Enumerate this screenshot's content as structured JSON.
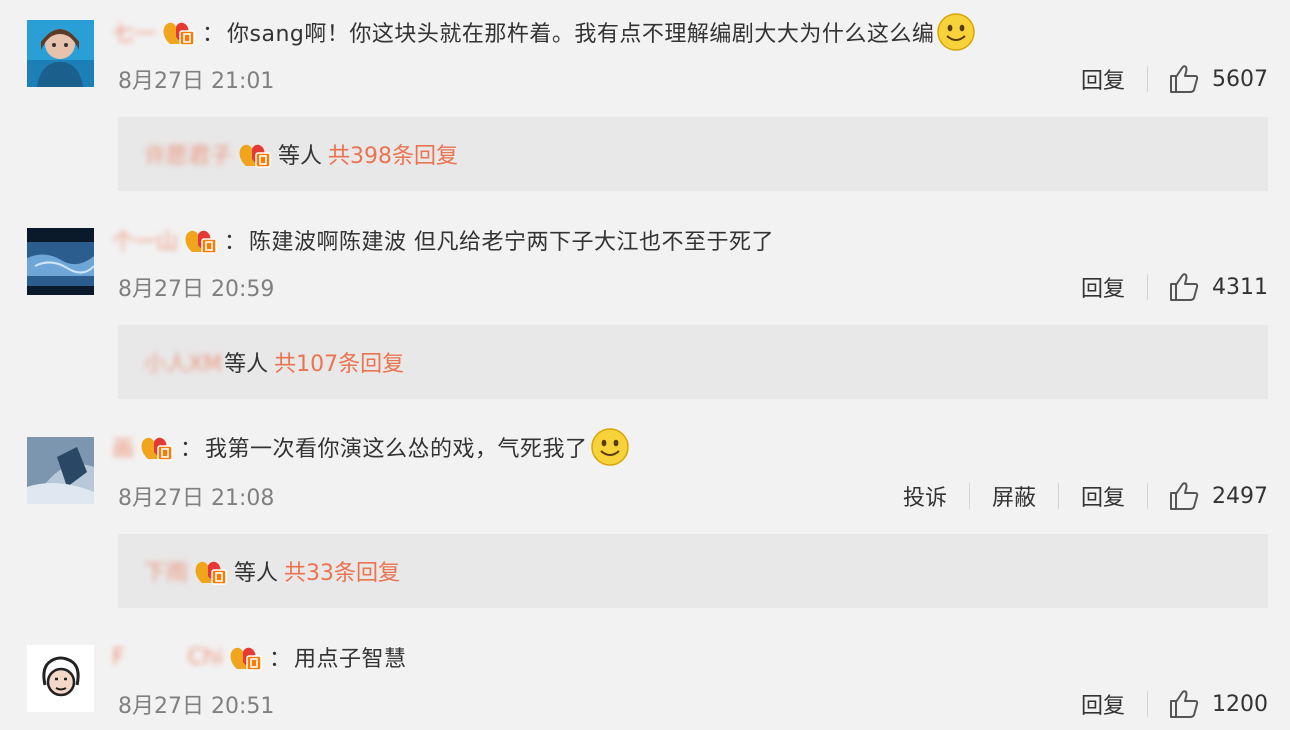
{
  "comments": [
    {
      "username": "七一",
      "text": "你sang啊！你这块头就在那杵着。我有点不理解编剧大大为什么这么编",
      "time": "8月27日 21:01",
      "actions": [
        "回复"
      ],
      "likes": "5607",
      "reply_user": "许愿君子",
      "reply_text": "等人",
      "reply_count": "共398条回复",
      "smiley": true
    },
    {
      "username": "个一山",
      "text": "陈建波啊陈建波 但凡给老宁两下子大江也不至于死了",
      "time": "8月27日 20:59",
      "actions": [
        "回复"
      ],
      "likes": "4311",
      "reply_user": "小人XM",
      "reply_text": "等人",
      "reply_count": "共107条回复",
      "smiley": false
    },
    {
      "username": "画",
      "text": "我第一次看你演这么怂的戏，气死我了",
      "time": "8月27日 21:08",
      "actions": [
        "投诉",
        "屏蔽",
        "回复"
      ],
      "likes": "2497",
      "reply_user": "下雨",
      "reply_text": "等人",
      "reply_count": "共33条回复",
      "smiley": true
    },
    {
      "username": "F         Chi",
      "text": "用点子智慧",
      "time": "8月27日 20:51",
      "actions": [
        "回复"
      ],
      "likes": "1200",
      "smiley": false
    }
  ],
  "colors": {
    "background": "#f2f2f2",
    "reply_box": "#e8e8e8",
    "accent_orange": "#eb7350",
    "timestamp_gray": "#808080",
    "text": "#333333"
  },
  "icons": {
    "vip": "vip-badge-icon",
    "like": "thumbs-up-icon",
    "smiley": "smiley-icon"
  }
}
